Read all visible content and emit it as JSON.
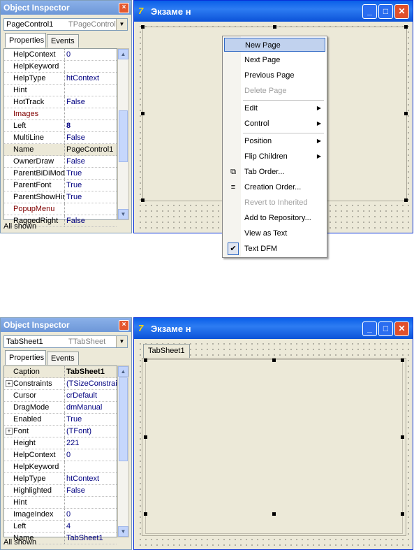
{
  "top": {
    "inspector": {
      "title": "Object Inspector",
      "close": "×",
      "component_name": "PageControl1",
      "component_type": "TPageControl",
      "tabs": [
        "Properties",
        "Events"
      ],
      "rows": [
        {
          "key": "HelpContext",
          "value": "0"
        },
        {
          "key": "HelpKeyword",
          "value": ""
        },
        {
          "key": "HelpType",
          "value": "htContext"
        },
        {
          "key": "Hint",
          "value": ""
        },
        {
          "key": "HotTrack",
          "value": "False"
        },
        {
          "key": "Images",
          "value": ""
        },
        {
          "key": "Left",
          "value": "8"
        },
        {
          "key": "MultiLine",
          "value": "False"
        },
        {
          "key": "Name",
          "value": "PageControl1"
        },
        {
          "key": "OwnerDraw",
          "value": "False"
        },
        {
          "key": "ParentBiDiMode",
          "value": "True"
        },
        {
          "key": "ParentFont",
          "value": "True"
        },
        {
          "key": "ParentShowHint",
          "value": "True"
        },
        {
          "key": "PopupMenu",
          "value": ""
        },
        {
          "key": "RaggedRight",
          "value": "False"
        }
      ],
      "status": "All shown"
    },
    "window": {
      "title": "Экзаме н",
      "icon": "7"
    },
    "menu": {
      "items": [
        {
          "label": "New Page"
        },
        {
          "label": "Next Page"
        },
        {
          "label": "Previous Page"
        },
        {
          "label": "Delete Page"
        },
        {
          "label": "Edit"
        },
        {
          "label": "Control"
        },
        {
          "label": "Position"
        },
        {
          "label": "Flip Children"
        },
        {
          "label": "Tab Order..."
        },
        {
          "label": "Creation Order..."
        },
        {
          "label": "Revert to Inherited"
        },
        {
          "label": "Add to Repository..."
        },
        {
          "label": "View as Text"
        },
        {
          "label": "Text DFM"
        }
      ]
    }
  },
  "bottom": {
    "inspector": {
      "title": "Object Inspector",
      "close": "×",
      "component_name": "TabSheet1",
      "component_type": "TTabSheet",
      "tabs": [
        "Properties",
        "Events"
      ],
      "rows": [
        {
          "key": "Caption",
          "value": "TabSheet1"
        },
        {
          "key": "Constraints",
          "value": "(TSizeConstraints)"
        },
        {
          "key": "Cursor",
          "value": "crDefault"
        },
        {
          "key": "DragMode",
          "value": "dmManual"
        },
        {
          "key": "Enabled",
          "value": "True"
        },
        {
          "key": "Font",
          "value": "(TFont)"
        },
        {
          "key": "Height",
          "value": "221"
        },
        {
          "key": "HelpContext",
          "value": "0"
        },
        {
          "key": "HelpKeyword",
          "value": ""
        },
        {
          "key": "HelpType",
          "value": "htContext"
        },
        {
          "key": "Highlighted",
          "value": "False"
        },
        {
          "key": "Hint",
          "value": ""
        },
        {
          "key": "ImageIndex",
          "value": "0"
        },
        {
          "key": "Left",
          "value": "4"
        },
        {
          "key": "Name",
          "value": "TabSheet1"
        }
      ],
      "status": "All shown"
    },
    "window": {
      "title": "Экзаме н",
      "icon": "7",
      "tab_caption": "TabSheet1"
    }
  },
  "glyphs": {
    "plus": "+",
    "scroll_up": "▲",
    "scroll_down": "▼",
    "combo_arrow": "▼",
    "submenu": "▶",
    "check": "✔",
    "tab_order_icon": "⧉",
    "creation_order_icon": "≡"
  }
}
